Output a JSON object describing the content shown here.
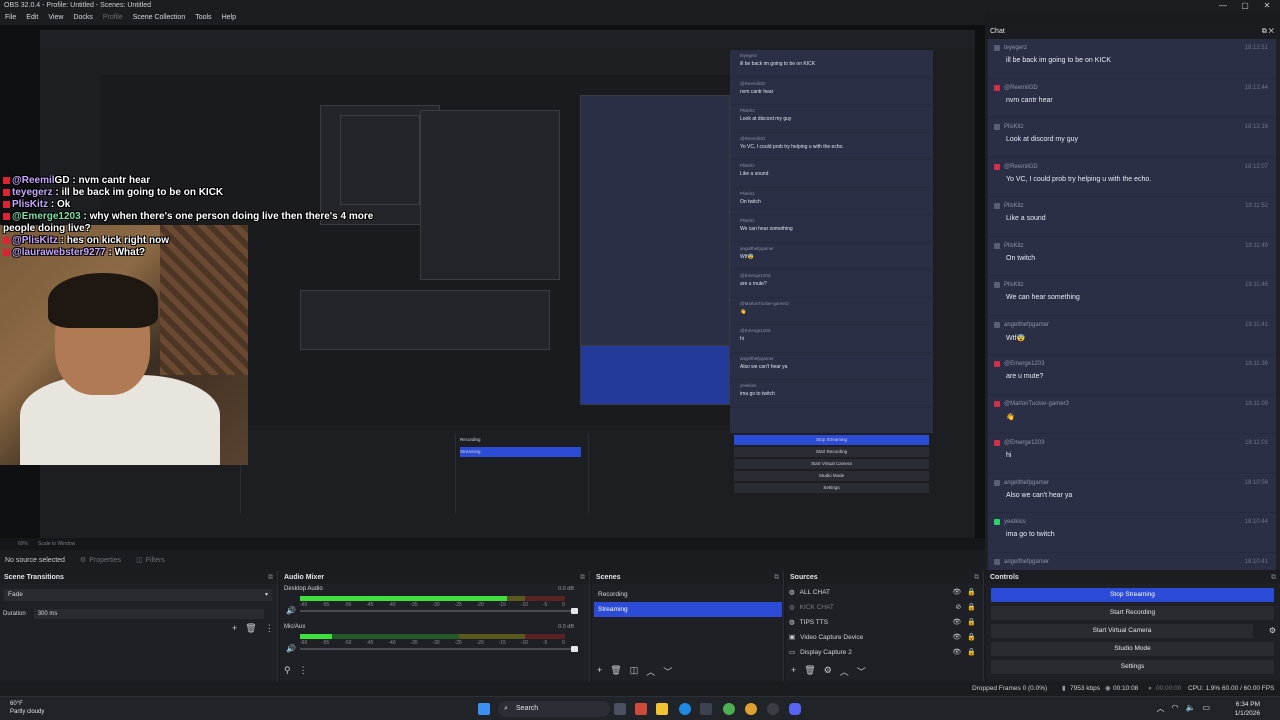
{
  "window": {
    "title": "OBS 32.0.4 - Profile: Untitled - Scenes: Untitled",
    "min": "—",
    "max": "▢",
    "close": "✕"
  },
  "menu": [
    "File",
    "Edit",
    "View",
    "Docks",
    "Profile",
    "Scene Collection",
    "Tools",
    "Help"
  ],
  "overlay_chat": [
    {
      "user": "@Reemil",
      "sep": "GD : ",
      "text": "nvm cantr hear"
    },
    {
      "user": "teyegerz",
      "sep": " : ",
      "text": "ill be back im going to be on KICK"
    },
    {
      "user": "PlisKitz",
      "sep": " : ",
      "text": "Ok"
    },
    {
      "user": "@Emerge1203",
      "sep": " : ",
      "text": "why when there's one person doing live then there's 4 more people doing live?"
    },
    {
      "user": "@PlisKitz",
      "sep": " : ",
      "text": "hes on kick right now"
    },
    {
      "user": "@laurawebster9277",
      "sep": " : ",
      "text": "What?"
    }
  ],
  "chat": {
    "title": "Chat",
    "messages": [
      {
        "user": "teyegerz",
        "time": "18:12:51",
        "text": "ill be back im going to be on KICK",
        "badge": "none"
      },
      {
        "user": "@ReemilGD",
        "time": "18:12:44",
        "text": "nvm cantr hear",
        "badge": "r"
      },
      {
        "user": "PlisKitz",
        "time": "18:12:16",
        "text": "Look at discord my guy",
        "badge": "none"
      },
      {
        "user": "@ReemilGD",
        "time": "18:12:07",
        "text": "Yo VC, I could prob try helping u with the echo.",
        "badge": "r"
      },
      {
        "user": "PlisKitz",
        "time": "18:11:52",
        "text": "Like a sound",
        "badge": "none"
      },
      {
        "user": "PlisKitz",
        "time": "18:11:49",
        "text": "On twitch",
        "badge": "none"
      },
      {
        "user": "PlisKitz",
        "time": "18:11:46",
        "text": "We can hear something",
        "badge": "none"
      },
      {
        "user": "angelthefpgamer",
        "time": "18:11:41",
        "text": "Wtf😨",
        "badge": "none"
      },
      {
        "user": "@Emerge1203",
        "time": "18:11:36",
        "text": "are u mute?",
        "badge": "r"
      },
      {
        "user": "@MarlonTucker-gamer3",
        "time": "18:11:09",
        "text": "👋",
        "badge": "r"
      },
      {
        "user": "@Emerge1203",
        "time": "18:11:01",
        "text": "hi",
        "badge": "r"
      },
      {
        "user": "angelthefpgamer",
        "time": "18:10:56",
        "text": "Also we can't hear ya",
        "badge": "none"
      },
      {
        "user": "yeetkiss",
        "time": "18:10:44",
        "text": "ima go to twitch",
        "badge": "g"
      },
      {
        "user": "angelthefpgamer",
        "time": "18:10:41",
        "text": "",
        "badge": "none"
      }
    ]
  },
  "zoom": {
    "value": "69%",
    "label": "Scale to Window"
  },
  "status": {
    "source": "No source selected",
    "properties": "Properties",
    "filters": "Filters"
  },
  "transitions": {
    "title": "Scene Transitions",
    "selected": "Fade",
    "duration_label": "Duration",
    "duration_value": "300 ms"
  },
  "mixer": {
    "title": "Audio Mixer",
    "channels": [
      {
        "name": "Desktop Audio",
        "db": "0.0 dB",
        "level": 0.78
      },
      {
        "name": "Mic/Aux",
        "db": "0.0 dB",
        "level": 0.12
      }
    ],
    "scale": [
      "-60",
      "-55",
      "-50",
      "-45",
      "-40",
      "-35",
      "-30",
      "-25",
      "-20",
      "-15",
      "-10",
      "-5",
      "0"
    ]
  },
  "scenes": {
    "title": "Scenes",
    "items": [
      "Recording",
      "Streaming"
    ],
    "selected": 1
  },
  "sources": {
    "title": "Sources",
    "items": [
      {
        "name": "ALL CHAT",
        "dim": false
      },
      {
        "name": "KICK CHAT",
        "dim": true
      },
      {
        "name": "TIPS TTS",
        "dim": false
      },
      {
        "name": "Video Capture Device",
        "dim": false
      },
      {
        "name": "Display Capture 2",
        "dim": false
      }
    ]
  },
  "controls": {
    "title": "Controls",
    "buttons": [
      "Stop Streaming",
      "Start Recording",
      "Start Virtual Camera",
      "Studio Mode",
      "Settings"
    ]
  },
  "stats": {
    "dropped": "Dropped Frames 0 (0.0%)",
    "kbps": "7953 kbps",
    "stream_time": "00:10:08",
    "rec_time": "00:00:00",
    "cpu": "CPU: 1.9%",
    "fps": "60.00 / 60.00 FPS"
  },
  "taskbar": {
    "weather_temp": "60°F",
    "weather_desc": "Partly cloudy",
    "search": "Search",
    "time": "6:34 PM",
    "date": "1/1/2026"
  },
  "colors": {
    "accent": "#2c4bd6",
    "chat_bg": "#2a2f45",
    "panel": "#1f2025"
  }
}
